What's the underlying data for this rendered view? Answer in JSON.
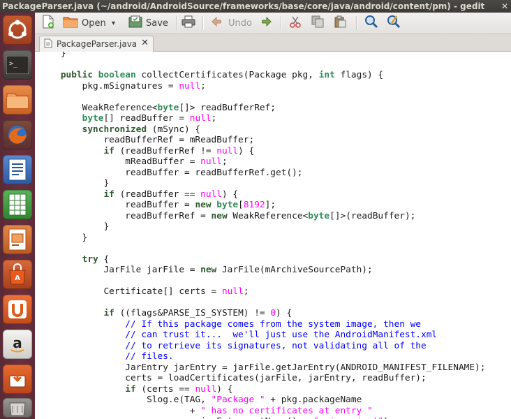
{
  "window": {
    "title": "PackageParser.java (~/android/AndroidSource/frameworks/base/core/java/android/content/pm) - gedit",
    "close_glyph": "✕"
  },
  "launcher": {
    "items": [
      {
        "name": "ubuntu-dash-icon"
      },
      {
        "name": "terminal-icon"
      },
      {
        "name": "files-icon"
      },
      {
        "name": "firefox-icon"
      },
      {
        "name": "writer-icon"
      },
      {
        "name": "calc-icon"
      },
      {
        "name": "impress-icon"
      },
      {
        "name": "software-center-icon"
      },
      {
        "name": "ubuntu-one-icon"
      },
      {
        "name": "amazon-icon"
      },
      {
        "name": "update-manager-icon"
      }
    ]
  },
  "toolbar": {
    "new_icon": "new-document-icon",
    "open_label": "Open",
    "open_arrow": "▾",
    "save_label": "Save",
    "undo_label": "Undo"
  },
  "tabs": [
    {
      "label": "PackageParser.java",
      "close_glyph": "✕"
    }
  ],
  "colors": {
    "keyword": "#2f5a2f",
    "type_keyword": "#2e8b57",
    "literal": "#ff00ff",
    "comment": "#0000ff",
    "launcher_bg": "#6a2f3e",
    "titlebar_bg": "#3c3b37"
  },
  "code_lines": [
    [
      [
        "tx",
        "    }"
      ]
    ],
    [
      [
        "tx",
        ""
      ]
    ],
    [
      [
        "tx",
        "    "
      ],
      [
        "kw",
        "public"
      ],
      [
        "tx",
        " "
      ],
      [
        "kwt",
        "boolean"
      ],
      [
        "tx",
        " collectCertificates(Package pkg, "
      ],
      [
        "kwt",
        "int"
      ],
      [
        "tx",
        " flags) {"
      ]
    ],
    [
      [
        "tx",
        "        pkg.mSignatures = "
      ],
      [
        "lit",
        "null"
      ],
      [
        "tx",
        ";"
      ]
    ],
    [
      [
        "tx",
        ""
      ]
    ],
    [
      [
        "tx",
        "        WeakReference<"
      ],
      [
        "kwt",
        "byte"
      ],
      [
        "tx",
        "[]> readBufferRef;"
      ]
    ],
    [
      [
        "tx",
        "        "
      ],
      [
        "kwt",
        "byte"
      ],
      [
        "tx",
        "[] readBuffer = "
      ],
      [
        "lit",
        "null"
      ],
      [
        "tx",
        ";"
      ]
    ],
    [
      [
        "tx",
        "        "
      ],
      [
        "kw",
        "synchronized"
      ],
      [
        "tx",
        " (mSync) {"
      ]
    ],
    [
      [
        "tx",
        "            readBufferRef = mReadBuffer;"
      ]
    ],
    [
      [
        "tx",
        "            "
      ],
      [
        "kw",
        "if"
      ],
      [
        "tx",
        " (readBufferRef != "
      ],
      [
        "lit",
        "null"
      ],
      [
        "tx",
        ") {"
      ]
    ],
    [
      [
        "tx",
        "                mReadBuffer = "
      ],
      [
        "lit",
        "null"
      ],
      [
        "tx",
        ";"
      ]
    ],
    [
      [
        "tx",
        "                readBuffer = readBufferRef.get();"
      ]
    ],
    [
      [
        "tx",
        "            }"
      ]
    ],
    [
      [
        "tx",
        "            "
      ],
      [
        "kw",
        "if"
      ],
      [
        "tx",
        " (readBuffer == "
      ],
      [
        "lit",
        "null"
      ],
      [
        "tx",
        ") {"
      ]
    ],
    [
      [
        "tx",
        "                readBuffer = "
      ],
      [
        "kw",
        "new"
      ],
      [
        "tx",
        " "
      ],
      [
        "kwt",
        "byte"
      ],
      [
        "tx",
        "["
      ],
      [
        "num",
        "8192"
      ],
      [
        "tx",
        "];"
      ]
    ],
    [
      [
        "tx",
        "                readBufferRef = "
      ],
      [
        "kw",
        "new"
      ],
      [
        "tx",
        " WeakReference<"
      ],
      [
        "kwt",
        "byte"
      ],
      [
        "tx",
        "[]>(readBuffer);"
      ]
    ],
    [
      [
        "tx",
        "            }"
      ]
    ],
    [
      [
        "tx",
        "        }"
      ]
    ],
    [
      [
        "tx",
        ""
      ]
    ],
    [
      [
        "tx",
        "        "
      ],
      [
        "kw",
        "try"
      ],
      [
        "tx",
        " {"
      ]
    ],
    [
      [
        "tx",
        "            JarFile jarFile = "
      ],
      [
        "kw",
        "new"
      ],
      [
        "tx",
        " JarFile(mArchiveSourcePath);"
      ]
    ],
    [
      [
        "tx",
        ""
      ]
    ],
    [
      [
        "tx",
        "            Certificate[] certs = "
      ],
      [
        "lit",
        "null"
      ],
      [
        "tx",
        ";"
      ]
    ],
    [
      [
        "tx",
        ""
      ]
    ],
    [
      [
        "tx",
        "            "
      ],
      [
        "kw",
        "if"
      ],
      [
        "tx",
        " ((flags&PARSE_IS_SYSTEM) != "
      ],
      [
        "num",
        "0"
      ],
      [
        "tx",
        ") {"
      ]
    ],
    [
      [
        "cm",
        "                // If this package comes from the system image, then we"
      ]
    ],
    [
      [
        "cm",
        "                // can trust it...  we'll just use the AndroidManifest.xml"
      ]
    ],
    [
      [
        "cm",
        "                // to retrieve its signatures, not validating all of the"
      ]
    ],
    [
      [
        "cm",
        "                // files."
      ]
    ],
    [
      [
        "tx",
        "                JarEntry jarEntry = jarFile.getJarEntry(ANDROID_MANIFEST_FILENAME);"
      ]
    ],
    [
      [
        "tx",
        "                certs = loadCertificates(jarFile, jarEntry, readBuffer);"
      ]
    ],
    [
      [
        "tx",
        "                "
      ],
      [
        "kw",
        "if"
      ],
      [
        "tx",
        " (certs == "
      ],
      [
        "lit",
        "null"
      ],
      [
        "tx",
        ") {"
      ]
    ],
    [
      [
        "tx",
        "                    Slog.e(TAG, "
      ],
      [
        "str",
        "\"Package \""
      ],
      [
        "tx",
        " + pkg.packageName"
      ]
    ],
    [
      [
        "tx",
        "                            + "
      ],
      [
        "str",
        "\" has no certificates at entry \""
      ]
    ],
    [
      [
        "tx",
        "                            + jarEntry.getName() + "
      ],
      [
        "str",
        "\": ignoring!\""
      ],
      [
        "tx",
        ");"
      ]
    ]
  ]
}
